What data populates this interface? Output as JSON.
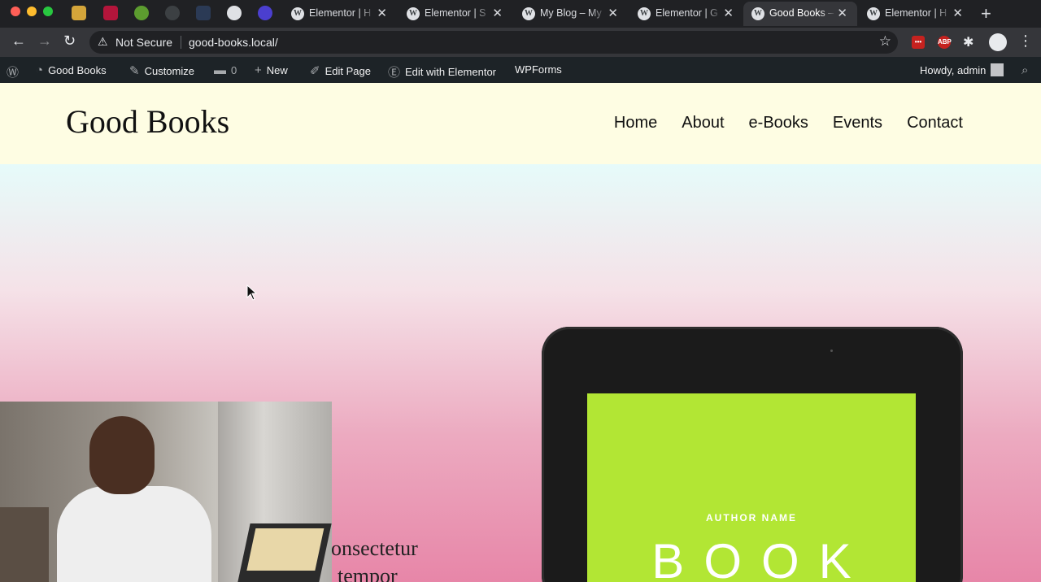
{
  "browser": {
    "tabs": [
      {
        "title": "Elementor | H",
        "active": false
      },
      {
        "title": "Elementor | S",
        "active": false
      },
      {
        "title": "My Blog – My",
        "active": false
      },
      {
        "title": "Elementor | G",
        "active": false
      },
      {
        "title": "Good Books –",
        "active": true
      },
      {
        "title": "Elementor | H",
        "active": false
      }
    ],
    "tab_favicon_letter": "W",
    "close_glyph": "✕",
    "new_tab_glyph": "+",
    "security_label": "Not Secure",
    "url": "good-books.local/",
    "extensions": {
      "abp_label": "ABP",
      "red_ext_label": "•••"
    }
  },
  "admin_bar": {
    "site_name": "Good Books",
    "customize": "Customize",
    "comments_count": "0",
    "new": "New",
    "edit_page": "Edit Page",
    "edit_with_elementor": "Edit with Elementor",
    "wpforms": "WPForms",
    "howdy": "Howdy, admin"
  },
  "site": {
    "logo": "Good Books",
    "nav": [
      "Home",
      "About",
      "e-Books",
      "Events",
      "Contact"
    ]
  },
  "hero": {
    "text_line1": "onsectetur",
    "text_line2": "tempor",
    "book_author": "AUTHOR NAME",
    "book_title": "BOOK"
  },
  "colors": {
    "header_bg": "#fefde3",
    "book_cover": "#b2e634",
    "admin_bar_bg": "#1d2327"
  }
}
